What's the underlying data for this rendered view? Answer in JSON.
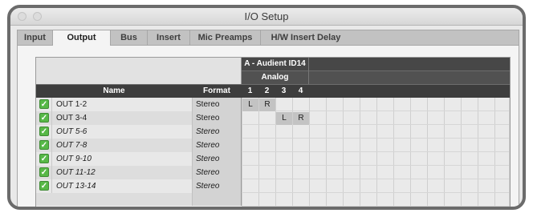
{
  "window": {
    "title": "I/O Setup"
  },
  "tabs": [
    {
      "label": "Input",
      "active": false
    },
    {
      "label": "Output",
      "active": true
    },
    {
      "label": "Bus",
      "active": false
    },
    {
      "label": "Insert",
      "active": false
    },
    {
      "label": "Mic Preamps",
      "active": false
    },
    {
      "label": "H/W Insert Delay",
      "active": false
    }
  ],
  "grid": {
    "device": "A - Audient ID14",
    "group": "Analog",
    "channels": [
      "1",
      "2",
      "3",
      "4"
    ]
  },
  "columns": {
    "name": "Name",
    "format": "Format"
  },
  "rows": [
    {
      "name": "OUT 1-2",
      "format": "Stereo",
      "checked": true,
      "italic": false,
      "assign": [
        "L",
        "R",
        "",
        ""
      ]
    },
    {
      "name": "OUT 3-4",
      "format": "Stereo",
      "checked": true,
      "italic": false,
      "assign": [
        "",
        "",
        "L",
        "R"
      ]
    },
    {
      "name": "OUT 5-6",
      "format": "Stereo",
      "checked": true,
      "italic": true,
      "assign": [
        "",
        "",
        "",
        ""
      ]
    },
    {
      "name": "OUT 7-8",
      "format": "Stereo",
      "checked": true,
      "italic": true,
      "assign": [
        "",
        "",
        "",
        ""
      ]
    },
    {
      "name": "OUT 9-10",
      "format": "Stereo",
      "checked": true,
      "italic": true,
      "assign": [
        "",
        "",
        "",
        ""
      ]
    },
    {
      "name": "OUT 11-12",
      "format": "Stereo",
      "checked": true,
      "italic": true,
      "assign": [
        "",
        "",
        "",
        ""
      ]
    },
    {
      "name": "OUT 13-14",
      "format": "Stereo",
      "checked": true,
      "italic": true,
      "assign": [
        "",
        "",
        "",
        ""
      ]
    }
  ]
}
